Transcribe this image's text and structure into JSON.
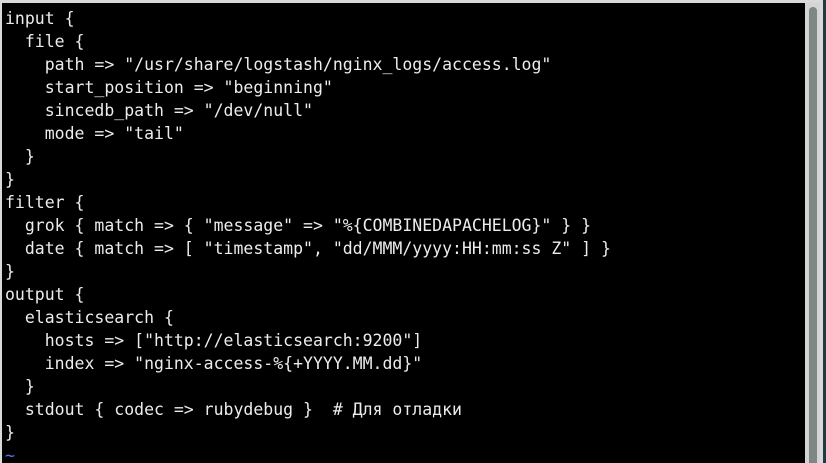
{
  "editor": {
    "lines": [
      "input {",
      "  file {",
      "    path => \"/usr/share/logstash/nginx_logs/access.log\"",
      "    start_position => \"beginning\"",
      "    sincedb_path => \"/dev/null\"",
      "    mode => \"tail\"",
      "  }",
      "}",
      "filter {",
      "  grok { match => { \"message\" => \"%{COMBINEDAPACHELOG}\" } }",
      "  date { match => [ \"timestamp\", \"dd/MMM/yyyy:HH:mm:ss Z\" ] }",
      "}",
      "output {",
      "  elasticsearch {",
      "    hosts => [\"http://elasticsearch:9200\"]",
      "    index => \"nginx-access-%{+YYYY.MM.dd}\"",
      "  }",
      "  stdout { codec => rubydebug }  # Для отладки",
      "}"
    ],
    "empty_line_marker": "~"
  },
  "colors": {
    "background": "#000000",
    "text": "#ececec",
    "tilde": "#5b6cf0"
  }
}
